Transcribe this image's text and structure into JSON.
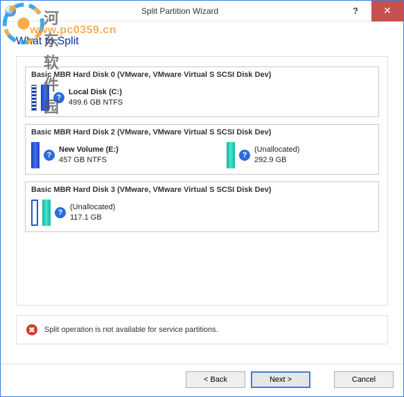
{
  "window": {
    "title": "Split Partition Wizard",
    "help": "?",
    "close": "✕"
  },
  "watermark": {
    "cn": "河东软件园",
    "url": "www.pc0359.cn"
  },
  "header": {
    "title": "What to Split"
  },
  "disks": [
    {
      "label": "Basic MBR Hard Disk 0 (VMware, VMware Virtual S SCSI Disk Dev)",
      "partitions": [
        {
          "bars": [
            "blue-stripe",
            "blue"
          ],
          "icon": "?",
          "name": "Local Disk (C:)",
          "size": "499.6 GB NTFS"
        }
      ]
    },
    {
      "label": "Basic MBR Hard Disk 2 (VMware, VMware Virtual S SCSI Disk Dev)",
      "partitions": [
        {
          "bars": [
            "blue"
          ],
          "icon": "?",
          "name": "New Volume (E:)",
          "size": "457 GB NTFS"
        },
        {
          "bars": [
            "teal"
          ],
          "icon": "?",
          "name": "(Unallocated)",
          "size": "292.9 GB",
          "align": "right"
        }
      ]
    },
    {
      "label": "Basic MBR Hard Disk 3 (VMware, VMware Virtual S SCSI Disk Dev)",
      "partitions": [
        {
          "bars": [
            "blue-outline",
            "teal"
          ],
          "icon": "?",
          "name": "(Unallocated)",
          "size": "117.1 GB"
        }
      ]
    }
  ],
  "status": {
    "text": "Split operation is not available for service partitions."
  },
  "footer": {
    "back": "< Back",
    "next": "Next >",
    "cancel": "Cancel"
  }
}
